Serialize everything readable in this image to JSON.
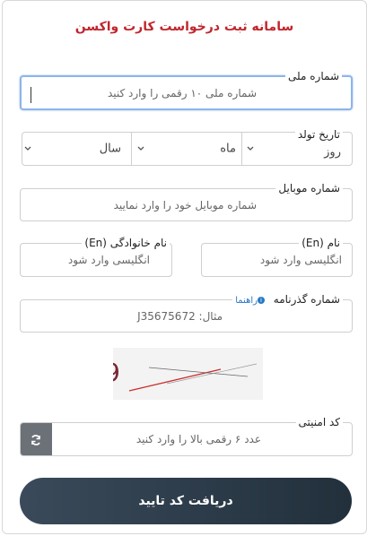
{
  "title": "سامانه ثبت درخواست کارت واکسن",
  "national_id": {
    "label": "شماره ملی",
    "placeholder": "شماره ملی ۱۰ رقمی را وارد کنید"
  },
  "birth_date": {
    "label": "تاریخ تولد",
    "day": "روز",
    "month": "ماه",
    "year": "سال"
  },
  "mobile": {
    "label": "شماره موبایل",
    "placeholder": "شماره موبایل خود را وارد نمایید"
  },
  "first_name": {
    "label": "نام (En)",
    "placeholder": "انگلیسی وارد شود"
  },
  "last_name": {
    "label": "نام خانوادگی (En)",
    "placeholder": "انگلیسی وارد شود"
  },
  "passport": {
    "label": "شماره گذرنامه",
    "help": "راهنما",
    "placeholder": "مثال: J35675672"
  },
  "captcha": {
    "text": "479299",
    "label": "کد امنیتی",
    "placeholder": "عدد ۶ رقمی بالا را وارد کنید"
  },
  "submit_label": "دریافت کد تایید",
  "colors": {
    "title": "#c0262d",
    "help": "#2778c4",
    "button": "#22303c",
    "refresh": "#6b7176"
  },
  "icons": {
    "refresh": "refresh-icon",
    "chevron": "chevron-down-icon",
    "info": "info-icon"
  }
}
